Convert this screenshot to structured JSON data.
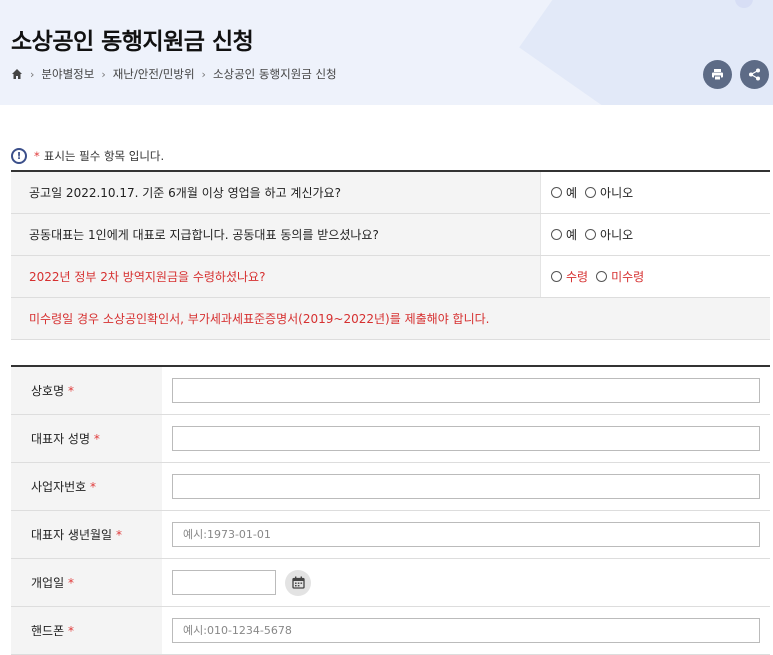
{
  "header": {
    "title": "소상공인 동행지원금 신청",
    "breadcrumb": [
      "분야별정보",
      "재난/안전/민방위",
      "소상공인 동행지원금 신청"
    ],
    "icons": {
      "home": "home-icon",
      "print": "print-icon",
      "share": "share-icon"
    }
  },
  "notice": {
    "star": "*",
    "text": "표시는 필수 항목 입니다."
  },
  "questions": [
    {
      "text": "공고일 2022.10.17. 기준 6개월 이상 영업을 하고 계신가요?",
      "options": [
        "예",
        "아니오"
      ]
    },
    {
      "text": "공동대표는 1인에게 대표로 지급합니다. 공동대표 동의를 받으셨나요?",
      "options": [
        "예",
        "아니오"
      ]
    },
    {
      "text": "2022년 정부 2차 방역지원금을 수령하셨나요?",
      "options": [
        "수령",
        "미수령"
      ]
    }
  ],
  "question_note": "미수령일 경우 소상공인확인서, 부가세과세표준증명서(2019~2022년)를 제출해야 합니다.",
  "form": {
    "required_mark": "*",
    "fields": [
      {
        "label": "상호명",
        "value": "",
        "placeholder": ""
      },
      {
        "label": "대표자 성명",
        "value": "",
        "placeholder": ""
      },
      {
        "label": "사업자번호",
        "value": "",
        "placeholder": ""
      },
      {
        "label": "대표자 생년월일",
        "value": "",
        "placeholder": "예시:1973-01-01"
      },
      {
        "label": "개업일",
        "value": "",
        "placeholder": ""
      },
      {
        "label": "핸드폰",
        "value": "",
        "placeholder": "예시:010-1234-5678"
      }
    ]
  },
  "colors": {
    "accent": "#3b4f8a",
    "required": "#e03a3a",
    "warning_text": "#d63030",
    "hero_bg": "#eef2fb"
  }
}
